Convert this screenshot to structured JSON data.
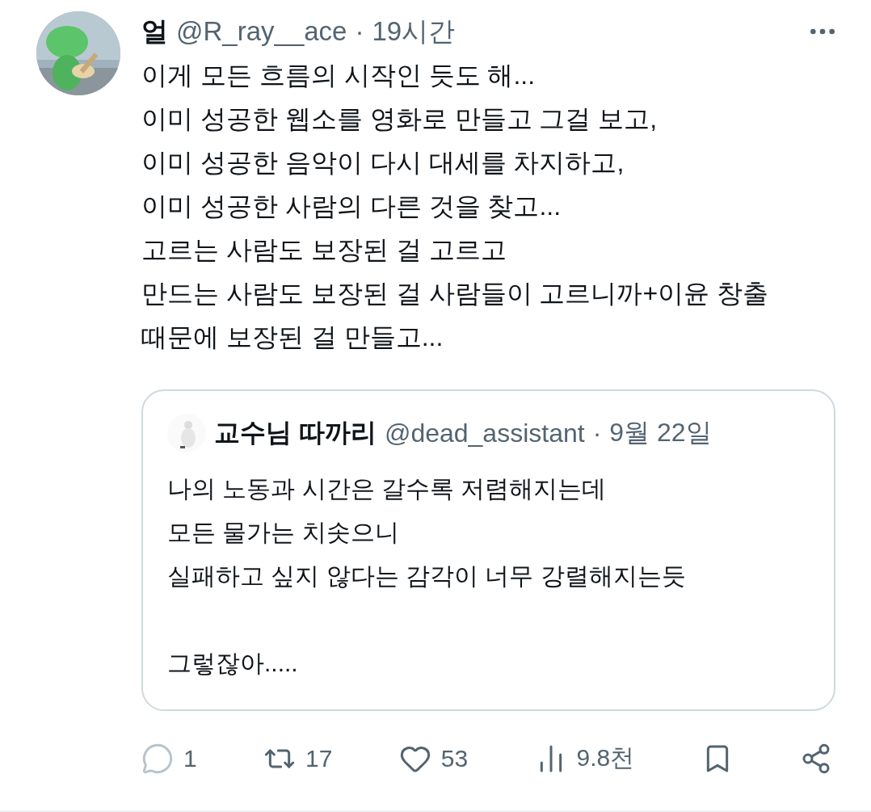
{
  "tweet": {
    "display_name": "얼",
    "handle": "@R_ray__ace",
    "separator": "·",
    "time": "19시간",
    "text": "이게 모든 흐름의 시작인 듯도 해...\n이미 성공한 웹소를 영화로 만들고 그걸 보고,\n이미 성공한 음악이 다시 대세를 차지하고,\n이미 성공한 사람의 다른 것을 찾고...\n고르는 사람도 보장된 걸 고르고\n만드는 사람도 보장된 걸 사람들이 고르니까+이윤 창출\n때문에 보장된 걸 만들고...",
    "quote": {
      "display_name": "교수님 따까리",
      "handle": "@dead_assistant",
      "separator": "·",
      "time": "9월 22일",
      "text": "나의 노동과 시간은 갈수록 저렴해지는데\n모든 물가는 치솟으니\n실패하고 싶지 않다는 감각이 너무 강렬해지는듯\n\n그렇잖아....."
    },
    "actions": [
      {
        "kind": "reply",
        "count": "1"
      },
      {
        "kind": "retweet",
        "count": "17"
      },
      {
        "kind": "like",
        "count": "53"
      },
      {
        "kind": "views",
        "count": "9.8천"
      },
      {
        "kind": "bookmark"
      },
      {
        "kind": "share"
      }
    ]
  }
}
